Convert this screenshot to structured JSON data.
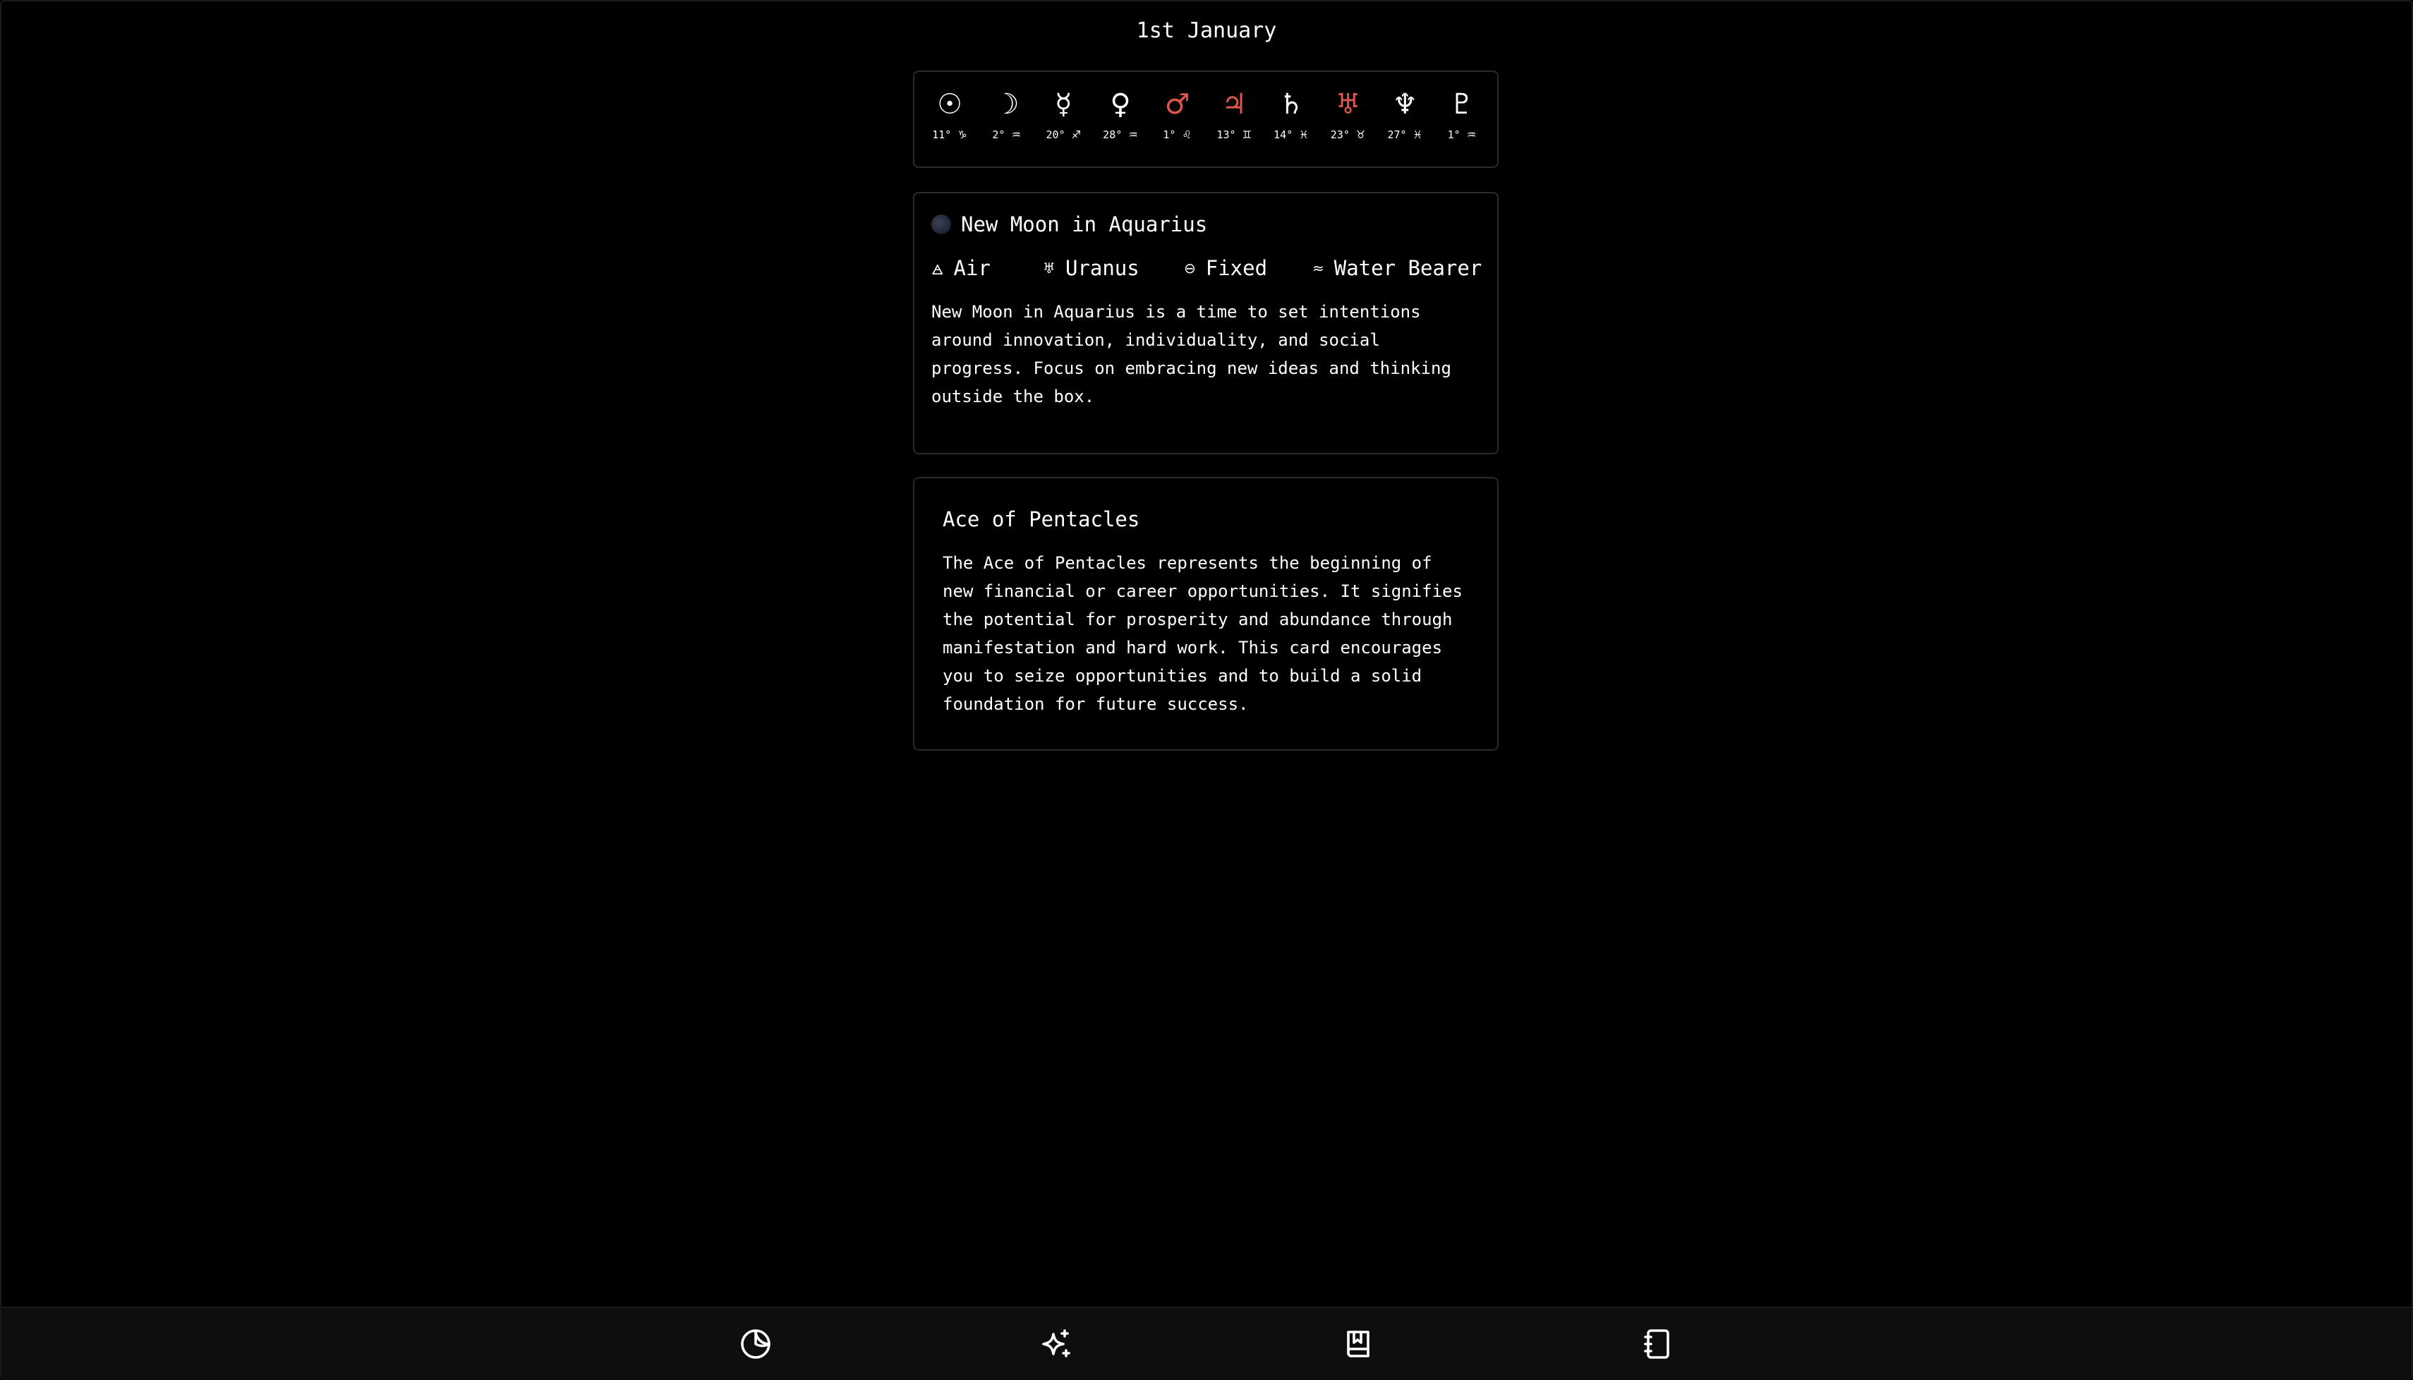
{
  "header": {
    "date": "1st January"
  },
  "planets": [
    {
      "name": "sun",
      "glyph": "☉",
      "degree": "11°",
      "sign": "♑",
      "color": "#ffffff"
    },
    {
      "name": "moon",
      "glyph": "☽",
      "degree": "2°",
      "sign": "♒",
      "color": "#ffffff"
    },
    {
      "name": "mercury",
      "glyph": "☿",
      "degree": "20°",
      "sign": "♐",
      "color": "#ffffff"
    },
    {
      "name": "venus",
      "glyph": "♀",
      "degree": "28°",
      "sign": "♒",
      "color": "#ffffff"
    },
    {
      "name": "mars",
      "glyph": "♂",
      "degree": "1°",
      "sign": "♌",
      "color": "#e0564f"
    },
    {
      "name": "jupiter",
      "glyph": "♃",
      "degree": "13°",
      "sign": "♊",
      "color": "#e0564f"
    },
    {
      "name": "saturn",
      "glyph": "♄",
      "degree": "14°",
      "sign": "♓",
      "color": "#ffffff"
    },
    {
      "name": "uranus",
      "glyph": "♅",
      "degree": "23°",
      "sign": "♉",
      "color": "#e0564f"
    },
    {
      "name": "neptune",
      "glyph": "♆",
      "degree": "27°",
      "sign": "♓",
      "color": "#ffffff"
    },
    {
      "name": "pluto",
      "glyph": "♇",
      "degree": "1°",
      "sign": "♒",
      "color": "#ffffff"
    }
  ],
  "moon_phase": {
    "title": "New Moon in Aquarius",
    "traits": {
      "element_icon": "🜁",
      "element": "Air",
      "ruler_icon": "♅",
      "ruler": "Uranus",
      "modality_icon": "⊖",
      "modality": "Fixed",
      "symbol_icon": "≈",
      "symbol": "Water Bearer"
    },
    "description": "New Moon in Aquarius is a time to set intentions around innovation, individuality, and social progress. Focus on embracing new ideas and thinking outside the box."
  },
  "tarot": {
    "title": "Ace of Pentacles",
    "description": "The Ace of Pentacles represents the beginning of new financial or career opportunities. It signifies the potential for prosperity and abundance through manifestation and hard work. This card encourages you to seize opportunities and to build a solid foundation for future success."
  },
  "nav": [
    {
      "name": "moon-phase-icon"
    },
    {
      "name": "sparkles-icon"
    },
    {
      "name": "book-bookmark-icon"
    },
    {
      "name": "notebook-icon"
    }
  ],
  "colors": {
    "background": "#000000",
    "card_border": "#2b2b2b",
    "accent_red": "#e0564f",
    "bottom_bar": "#0e0e0e"
  }
}
